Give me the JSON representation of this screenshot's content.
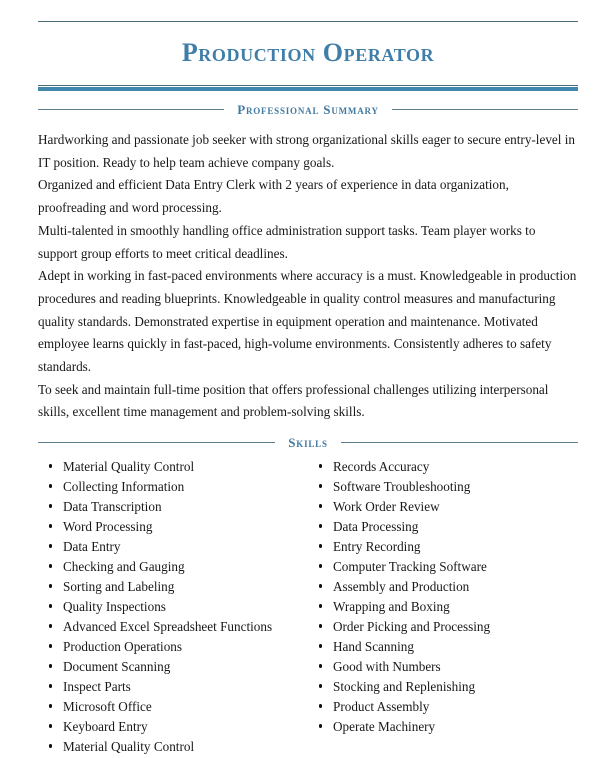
{
  "document": {
    "title": "Production Operator"
  },
  "sections": [
    {
      "id": "professional-summary",
      "label": "Professional Summary"
    },
    {
      "id": "skills",
      "label": "Skills"
    }
  ],
  "summary": {
    "label": "Professional Summary",
    "paragraphs": [
      "Hardworking and passionate job seeker with strong organizational skills eager to secure entry-level in IT position. Ready to help team achieve company goals.",
      "Organized and efficient Data Entry Clerk with 2 years of experience in data organization, proofreading and word processing.",
      "Multi-talented in smoothly handling office administration support tasks. Team player works to support group efforts to meet critical deadlines.",
      "Adept in working in fast-paced environments where accuracy is a must. Knowledgeable in production procedures and reading blueprints. Knowledgeable in quality control measures and manufacturing quality standards. Demonstrated expertise in equipment operation and maintenance. Motivated employee learns quickly in fast-paced, high-volume environments. Consistently adheres to safety standards.",
      "To seek and maintain full-time position that offers professional challenges utilizing interpersonal skills, excellent time management and problem-solving skills."
    ]
  },
  "skills": {
    "label": "Skills",
    "left_column": [
      "Material Quality Control",
      "Collecting Information",
      "Data Transcription",
      "Word Processing",
      "Data Entry",
      "Checking and Gauging",
      "Sorting and Labeling",
      "Quality Inspections",
      "Advanced Excel Spreadsheet Functions",
      "Production Operations",
      "Document Scanning",
      "Inspect Parts",
      "Microsoft Office",
      "Keyboard Entry",
      "Material Quality Control"
    ],
    "right_column": [
      "Records Accuracy",
      "Software Troubleshooting",
      "Work Order Review",
      "Data Processing",
      "Entry Recording",
      "Computer Tracking Software",
      "Assembly and Production",
      "Wrapping and Boxing",
      "Order Picking and Processing",
      "Hand Scanning",
      "Good with Numbers",
      "Stocking and Replenishing",
      "Product Assembly",
      "Operate Machinery"
    ]
  },
  "colors": {
    "title": "#3f7ea8",
    "section_label": "#4279a0",
    "rule_thin": "#4a6d79",
    "rule_thick": "#4287ad",
    "body_text": "#181818",
    "page_background": "#ffffff"
  }
}
